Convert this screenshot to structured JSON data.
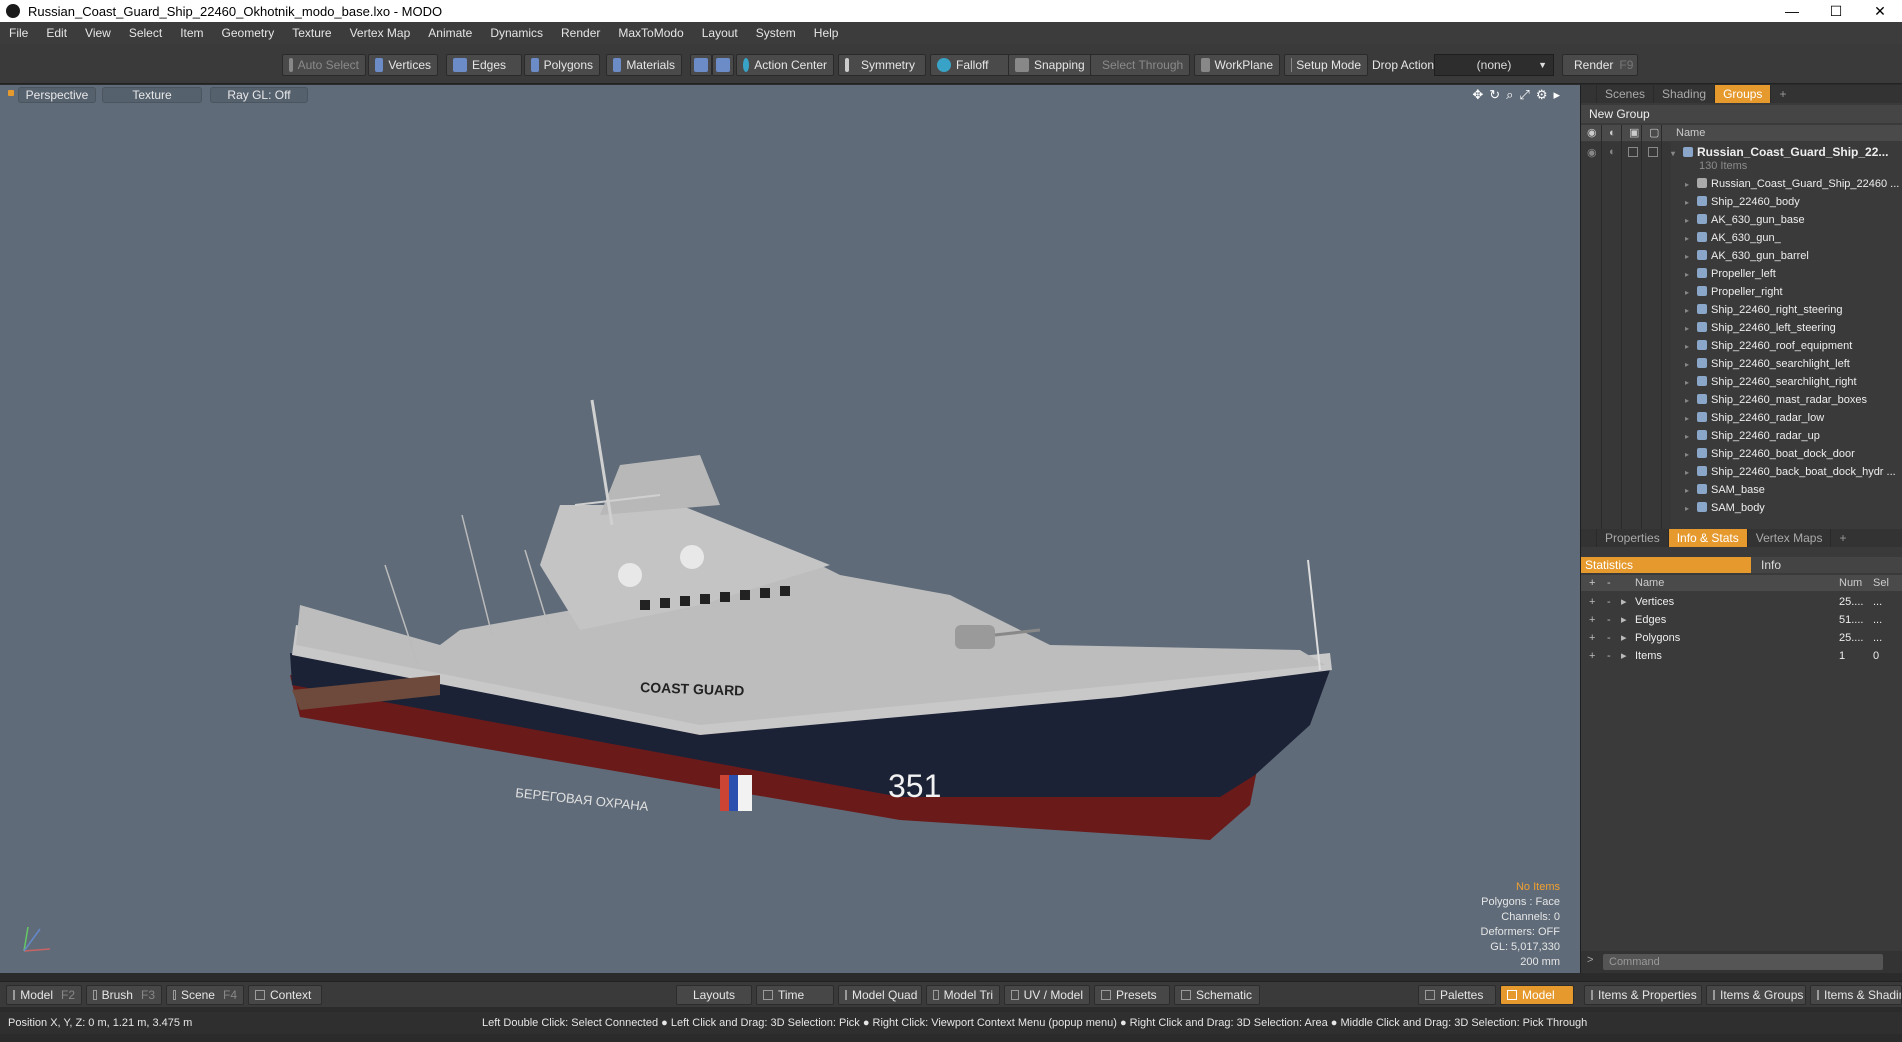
{
  "window": {
    "title": "Russian_Coast_Guard_Ship_22460_Okhotnik_modo_base.lxo - MODO",
    "minimize": "—",
    "maximize": "☐",
    "close": "✕"
  },
  "menu": [
    "File",
    "Edit",
    "View",
    "Select",
    "Item",
    "Geometry",
    "Texture",
    "Vertex Map",
    "Animate",
    "Dynamics",
    "Render",
    "MaxToModo",
    "Layout",
    "System",
    "Help"
  ],
  "toolbar": {
    "auto_select": "Auto Select",
    "vertices": "Vertices",
    "edges": "Edges",
    "polygons": "Polygons",
    "materials": "Materials",
    "action_center": "Action Center",
    "symmetry": "Symmetry",
    "falloff": "Falloff",
    "snapping": "Snapping",
    "select_through": "Select Through",
    "workplane": "WorkPlane",
    "setup_mode": "Setup Mode",
    "drop_action_label": "Drop Action",
    "drop_action_value": "(none)",
    "render": "Render",
    "render_key": "F9"
  },
  "viewport": {
    "view_mode": "Perspective",
    "shading": "Texture",
    "raygl": "Ray GL: Off",
    "ship": {
      "hull_number": "351",
      "side_text_en": "COAST GUARD",
      "side_text_ru": "БЕРЕГОВАЯ ОХРАНА"
    },
    "info": {
      "selection": "No Items",
      "polygons": "Polygons : Face",
      "channels": "Channels: 0",
      "deformers": "Deformers: OFF",
      "gl": "GL: 5,017,330",
      "grid": "200 mm"
    }
  },
  "groups_panel": {
    "tabs": [
      "Scenes",
      "Shading",
      "Groups"
    ],
    "active_tab": "Groups",
    "new_group": "New Group",
    "name_header": "Name",
    "root": "Russian_Coast_Guard_Ship_22...",
    "root_count": "130 Items",
    "items": [
      "Russian_Coast_Guard_Ship_22460 ...",
      "Ship_22460_body",
      "AK_630_gun_base",
      "AK_630_gun_",
      "AK_630_gun_barrel",
      "Propeller_left",
      "Propeller_right",
      "Ship_22460_right_steering",
      "Ship_22460_left_steering",
      "Ship_22460_roof_equipment",
      "Ship_22460_searchlight_left",
      "Ship_22460_searchlight_right",
      "Ship_22460_mast_radar_boxes",
      "Ship_22460_radar_low",
      "Ship_22460_radar_up",
      "Ship_22460_boat_dock_door",
      "Ship_22460_back_boat_dock_hydr ...",
      "SAM_base",
      "SAM_body"
    ]
  },
  "info_panel": {
    "tabs": [
      "Properties",
      "Info & Stats",
      "Vertex Maps"
    ],
    "active_tab": "Info & Stats",
    "statistics": "Statistics",
    "info": "Info",
    "headers": {
      "name": "Name",
      "num": "Num",
      "sel": "Sel"
    },
    "rows": [
      {
        "name": "Vertices",
        "num": "25....",
        "sel": "..."
      },
      {
        "name": "Edges",
        "num": "51....",
        "sel": "..."
      },
      {
        "name": "Polygons",
        "num": "25....",
        "sel": "..."
      },
      {
        "name": "Items",
        "num": "1",
        "sel": "0"
      }
    ]
  },
  "command": {
    "placeholder": "Command"
  },
  "bottom_tabs": {
    "model": "Model",
    "model_key": "F2",
    "brush": "Brush",
    "brush_key": "F3",
    "scene": "Scene",
    "scene_key": "F4",
    "context": "Context",
    "layouts": "Layouts",
    "time": "Time",
    "model_quad": "Model Quad",
    "model_tri": "Model Tri",
    "uv_model": "UV / Model",
    "presets": "Presets",
    "schematic": "Schematic",
    "palettes": "Palettes",
    "model_active": "Model",
    "items_properties": "Items & Properties",
    "items_groups": "Items & Groups",
    "items_shading": "Items & Shadin"
  },
  "status": {
    "position": "Position X, Y, Z:   0 m, 1.21 m, 3.475 m",
    "hints": "Left Double Click: Select Connected ● Left Click and Drag: 3D Selection: Pick ● Right Click: Viewport Context Menu (popup menu) ● Right Click and Drag: 3D Selection: Area ● Middle Click and Drag: 3D Selection: Pick Through"
  },
  "colors": {
    "accent": "#e69a2e",
    "viewport_bg": "#5f6b79",
    "hull_dark": "#1c2236",
    "hull_red": "#6b1a1a",
    "superstructure": "#c8c8c8"
  }
}
